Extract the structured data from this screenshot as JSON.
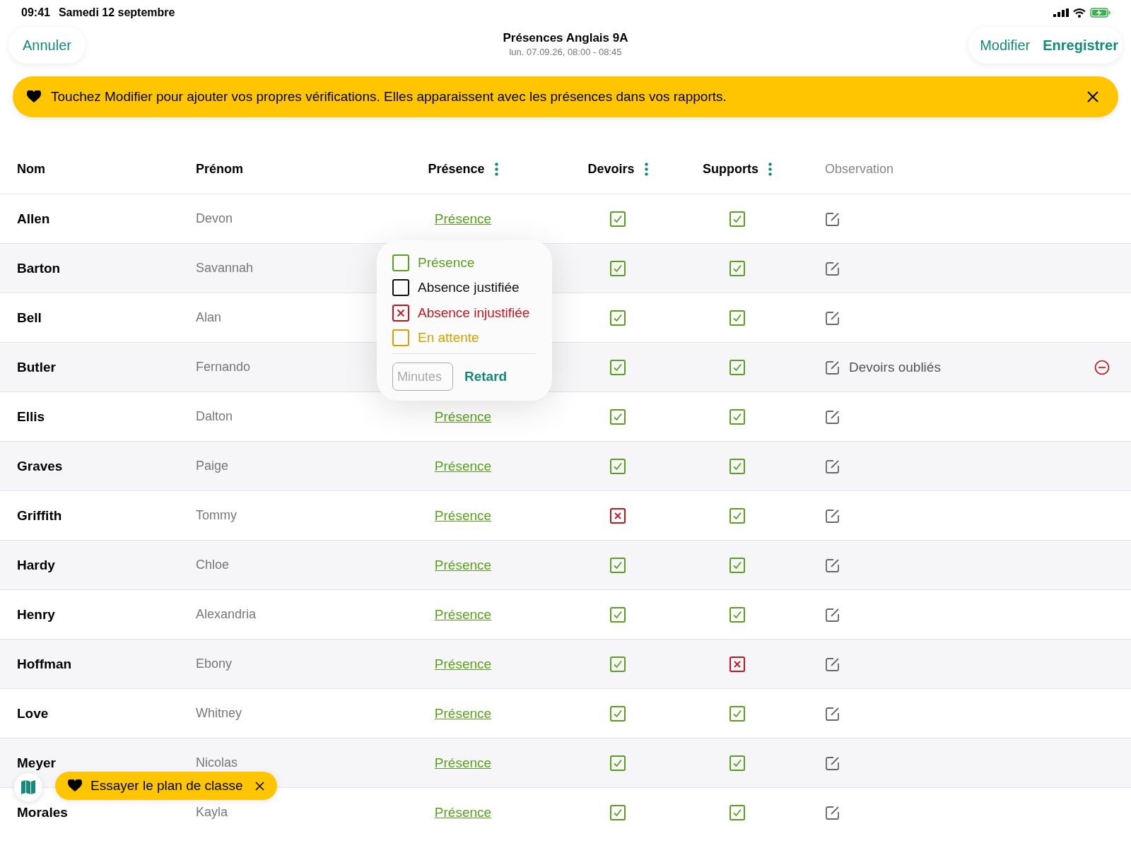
{
  "status_bar": {
    "time": "09:41",
    "date": "Samedi 12 septembre"
  },
  "nav": {
    "cancel": "Annuler",
    "title": "Présences Anglais 9A",
    "subtitle": "lun. 07.09.26, 08:00 - 08:45",
    "edit": "Modifier",
    "save": "Enregistrer"
  },
  "banner": {
    "text": "Touchez Modifier pour ajouter vos propres vérifications. Elles apparaissent avec les présences dans vos rapports."
  },
  "table": {
    "columns": [
      {
        "label": "Nom",
        "disabled": false
      },
      {
        "label": "Prénom",
        "disabled": false
      },
      {
        "label": "Présence",
        "menu": true,
        "disabled": false
      },
      {
        "label": "Devoirs",
        "menu": true,
        "disabled": false
      },
      {
        "label": "Supports",
        "menu": true,
        "disabled": false
      },
      {
        "label": "Observation",
        "disabled": true
      }
    ],
    "rows": [
      {
        "last": "Allen",
        "first": "Devon",
        "presence": "Présence",
        "homework": true,
        "materials": true
      },
      {
        "last": "Barton",
        "first": "Savannah",
        "homework": true,
        "materials": true
      },
      {
        "last": "Bell",
        "first": "Alan",
        "homework": true,
        "materials": true
      },
      {
        "last": "Butler",
        "first": "Fernando",
        "homework": true,
        "materials": true,
        "observation": "Devoirs oubliés"
      },
      {
        "last": "Ellis",
        "first": "Dalton",
        "presence": "Présence",
        "homework": true,
        "materials": true
      },
      {
        "last": "Graves",
        "first": "Paige",
        "presence": "Présence",
        "homework": true,
        "materials": true
      },
      {
        "last": "Griffith",
        "first": "Tommy",
        "presence": "Présence",
        "homework": false,
        "materials": true
      },
      {
        "last": "Hardy",
        "first": "Chloe",
        "presence": "Présence",
        "homework": true,
        "materials": true
      },
      {
        "last": "Henry",
        "first": "Alexandria",
        "presence": "Présence",
        "homework": true,
        "materials": true
      },
      {
        "last": "Hoffman",
        "first": "Ebony",
        "presence": "Présence",
        "homework": true,
        "materials": false
      },
      {
        "last": "Love",
        "first": "Whitney",
        "presence": "Présence",
        "homework": true,
        "materials": true
      },
      {
        "last": "Meyer",
        "first": "Nicolas",
        "presence": "Présence",
        "homework": true,
        "materials": true
      },
      {
        "last": "Morales",
        "first": "Kayla",
        "presence": "Présence",
        "homework": true,
        "materials": true
      }
    ]
  },
  "popover": {
    "options": [
      {
        "label": "Présence",
        "color": "#5aa01e",
        "checked": false
      },
      {
        "label": "Absence justifiée",
        "color": "#111111",
        "checked": false
      },
      {
        "label": "Absence injustifiée",
        "color": "#c8141e",
        "checked": true
      },
      {
        "label": "En attente",
        "color": "#d9a000",
        "checked": false
      }
    ],
    "minutes_placeholder": "Minutes",
    "late": "Retard"
  },
  "toast": {
    "text": "Essayer le plan de classe"
  }
}
